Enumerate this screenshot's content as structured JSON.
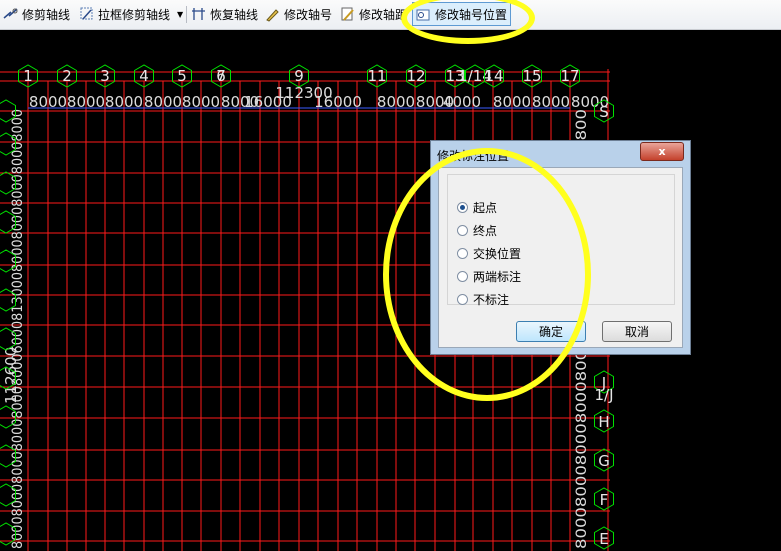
{
  "toolbar": {
    "items": [
      {
        "label": "修剪轴线",
        "icon": "trim-axis-icon"
      },
      {
        "label": "拉框修剪轴线",
        "icon": "box-trim-axis-icon",
        "dropdown": true
      },
      {
        "label": "恢复轴线",
        "icon": "restore-axis-icon"
      },
      {
        "label": "修改轴号",
        "icon": "edit-axis-number-icon"
      },
      {
        "label": "修改轴距",
        "icon": "edit-axis-spacing-icon"
      },
      {
        "label": "修改轴号位置",
        "icon": "edit-axis-number-position-icon",
        "active": true
      }
    ]
  },
  "drawing": {
    "top_axes": [
      "1",
      "2",
      "3",
      "4",
      "5",
      "6",
      "9",
      "11",
      "12",
      "13",
      "1/14",
      "14",
      "15",
      "17"
    ],
    "overlap_label": "7",
    "top_dims": [
      "8000",
      "8000",
      "8000",
      "8000",
      "8000",
      "8000",
      "16000",
      "16000",
      "8000",
      "8000",
      "4000",
      "8000",
      "8000",
      "8000"
    ],
    "top_total": "112300",
    "left_dim_text": "800080008000800080008000600081300080008000800080008000",
    "left_total": "112600",
    "right_axes": [
      "S",
      "J",
      "1/J",
      "H",
      "G",
      "F",
      "E"
    ],
    "right_dim_text": "800080008000800080003600800800080008000800",
    "colors": {
      "grid": "#ff1a1a",
      "axis_green": "#00e000",
      "dim_text": "#dcdcdc",
      "highlight": "#ffff1e"
    }
  },
  "dialog": {
    "title": "修改标注位置",
    "close_label": "x",
    "options": [
      {
        "label": "起点",
        "checked": true
      },
      {
        "label": "终点",
        "checked": false
      },
      {
        "label": "交换位置",
        "checked": false
      },
      {
        "label": "两端标注",
        "checked": false
      },
      {
        "label": "不标注",
        "checked": false
      }
    ],
    "ok_label": "确定",
    "cancel_label": "取消"
  }
}
